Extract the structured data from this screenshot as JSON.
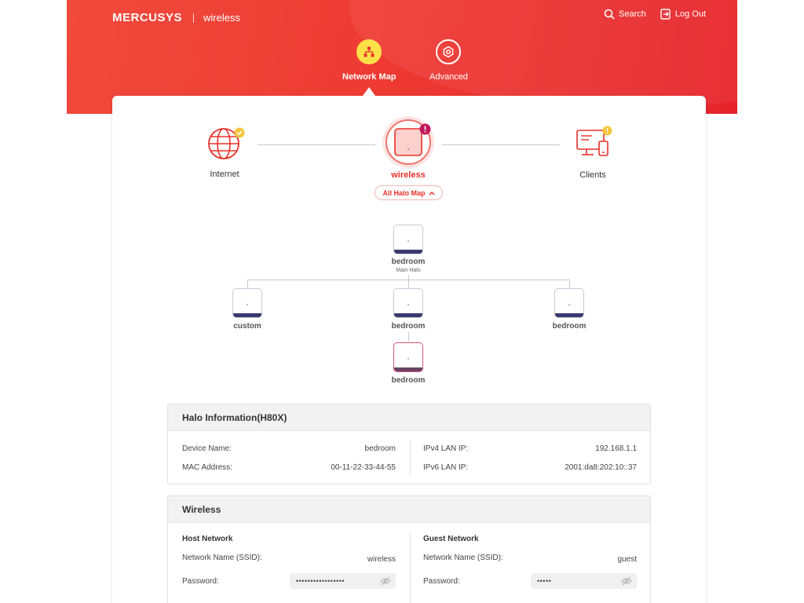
{
  "header": {
    "brand": "MERCUSYS",
    "model": "wireless",
    "search_label": "Search",
    "logout_label": "Log Out",
    "nav": [
      {
        "label": "Network Map",
        "active": true,
        "icon": "network-map-icon"
      },
      {
        "label": "Advanced",
        "active": false,
        "icon": "advanced-gear-icon"
      }
    ]
  },
  "topology": {
    "internet_label": "Internet",
    "router_label": "wireless",
    "clients_label": "Clients",
    "halo_map_button": "All Halo Map",
    "colors": {
      "accent": "#e8312a",
      "ok": "#f5c63c",
      "alert": "#c2185b"
    }
  },
  "halo_tree": {
    "main": {
      "label": "bedroom",
      "sub": "Main Halo"
    },
    "children": [
      {
        "label": "custom"
      },
      {
        "label": "bedroom"
      },
      {
        "label": "bedroom"
      }
    ],
    "grandchild": {
      "label": "bedroom"
    }
  },
  "halo_info": {
    "title": "Halo Information(H80X)",
    "device_name_label": "Device Name:",
    "device_name_value": "bedroom",
    "mac_label": "MAC Address:",
    "mac_value": "00-11-22-33-44-55",
    "ipv4_label": "IPv4 LAN IP:",
    "ipv4_value": "192.168.1.1",
    "ipv6_label": "IPv6 LAN IP:",
    "ipv6_value": "2001:da8:202:10::37"
  },
  "wireless": {
    "title": "Wireless",
    "host": {
      "heading": "Host Network",
      "ssid_label": "Network Name (SSID):",
      "ssid_value": "wireless",
      "password_label": "Password:",
      "password_value": "•••••••••••••••••"
    },
    "guest": {
      "heading": "Guest Network",
      "ssid_label": "Network Name (SSID):",
      "ssid_value": "guest",
      "password_label": "Password:",
      "password_value": "•••••"
    }
  }
}
